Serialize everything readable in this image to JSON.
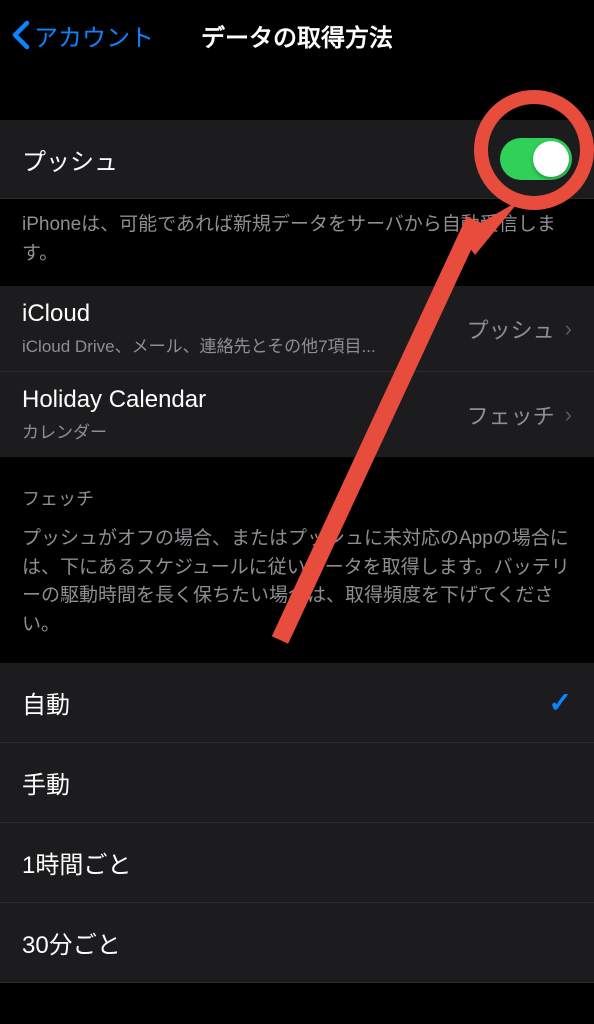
{
  "nav": {
    "back_label": "アカウント",
    "title": "データの取得方法"
  },
  "push": {
    "label": "プッシュ",
    "description": "iPhoneは、可能であれば新規データをサーバから自動受信します。"
  },
  "accounts": [
    {
      "title": "iCloud",
      "subtitle": "iCloud Drive、メール、連絡先とその他7項目...",
      "mode": "プッシュ"
    },
    {
      "title": "Holiday Calendar",
      "subtitle": "カレンダー",
      "mode": "フェッチ"
    }
  ],
  "fetch": {
    "header": "フェッチ",
    "description": "プッシュがオフの場合、またはプッシュに未対応のAppの場合には、下にあるスケジュールに従いデータを取得します。バッテリーの駆動時間を長く保ちたい場合は、取得頻度を下げてください。",
    "options": [
      {
        "label": "自動",
        "selected": true
      },
      {
        "label": "手動",
        "selected": false
      },
      {
        "label": "1時間ごと",
        "selected": false
      },
      {
        "label": "30分ごと",
        "selected": false
      }
    ]
  }
}
